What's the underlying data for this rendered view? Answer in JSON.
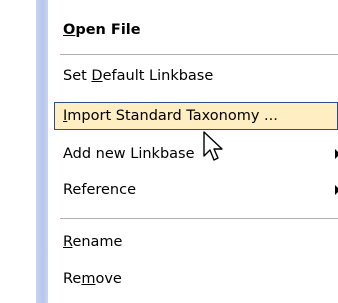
{
  "menu": {
    "items": [
      {
        "before": "",
        "mnemonic": "O",
        "after": "pen File"
      },
      {
        "before": "Set ",
        "mnemonic": "D",
        "after": "efault Linkbase"
      },
      {
        "before": "",
        "mnemonic": "I",
        "after": "mport Standard Taxonomy ..."
      },
      {
        "before": "Add new Linkbase",
        "mnemonic": "",
        "after": ""
      },
      {
        "before": "Reference",
        "mnemonic": "",
        "after": ""
      },
      {
        "before": "",
        "mnemonic": "R",
        "after": "ename"
      },
      {
        "before": "Re",
        "mnemonic": "m",
        "after": "ove"
      }
    ]
  }
}
